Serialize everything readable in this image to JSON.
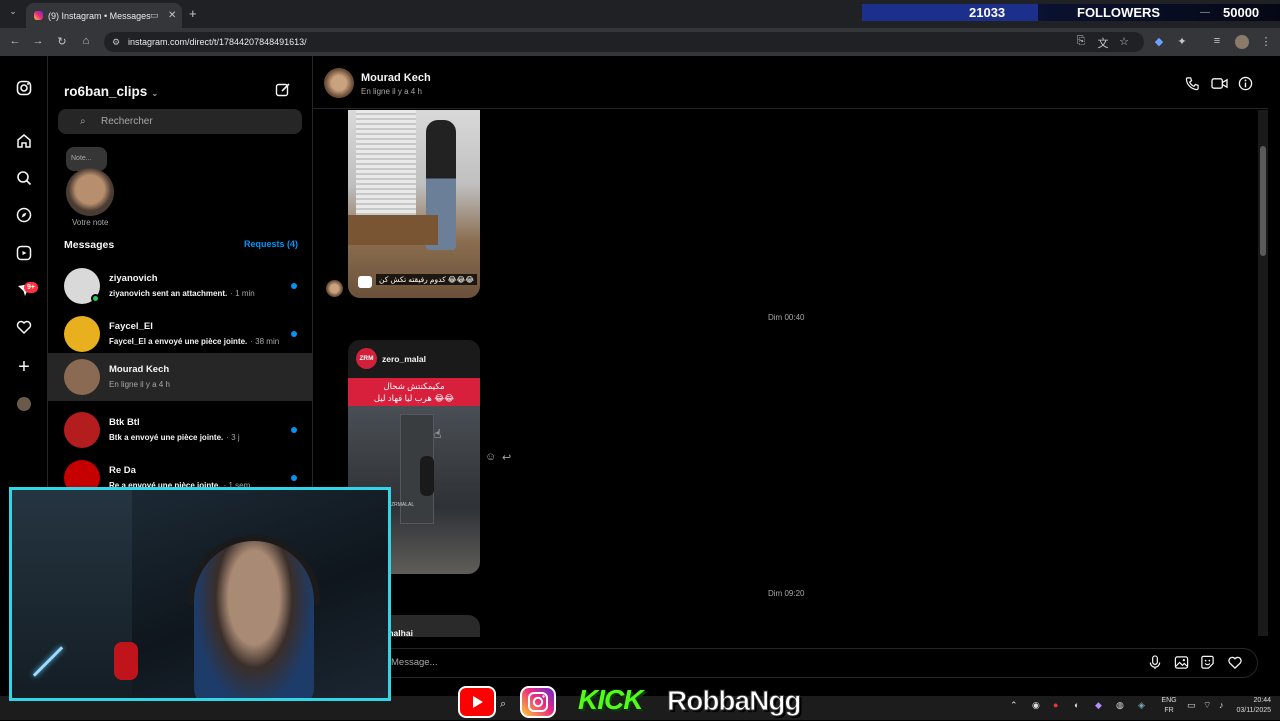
{
  "browser": {
    "tab_title": "(9) Instagram • Messages",
    "url": "instagram.com/direct/t/17844207848491613/"
  },
  "overlay": {
    "followers_current": "21033",
    "followers_label": "FOLLOWERS",
    "followers_goal": "50000",
    "progress_fraction": 0.42,
    "stream_name": "RobbaNgg",
    "kick_label": "KICK"
  },
  "sidebar": {
    "notification_badge": "9+"
  },
  "inbox": {
    "account": "ro6ban_clips",
    "search_placeholder": "Rechercher",
    "note_bubble": "Note...",
    "note_caption": "Votre note",
    "messages_heading": "Messages",
    "requests_label": "Requests (4)",
    "conversations": [
      {
        "name": "ziyanovich",
        "preview": "ziyanovich sent an attachment.",
        "time": "· 1 min",
        "unread": true,
        "color": "#d9d9d9"
      },
      {
        "name": "Faycel_El",
        "preview": "Faycel_El a envoyé une pièce jointe.",
        "time": "· 38 min",
        "unread": true,
        "color": "#e8b01e"
      },
      {
        "name": "Mourad Kech",
        "preview": "En ligne il y a 4 h",
        "time": "",
        "unread": false,
        "color": "#8a6a52"
      },
      {
        "name": "Btk Btl",
        "preview": "Btk a envoyé une pièce jointe.",
        "time": "· 3 j",
        "unread": true,
        "color": "#b31d1d"
      },
      {
        "name": "Re Da",
        "preview": "Re a envoyé une pièce jointe.",
        "time": "· 1 sem.",
        "unread": true,
        "color": "#c40000"
      }
    ]
  },
  "chat": {
    "contact_name": "Mourad Kech",
    "contact_status": "En ligne il y a 4 h",
    "reel1_caption": "كدوم رفيقته تكش كن 😂😂😂",
    "day_sep_1": "Dim 00:40",
    "reel2_account": "zero_malal",
    "reel2_logo": "ZRM",
    "reel2_text_line1": "مكيمكنتش شحال",
    "reel2_text_line2": "هرب ليا فهاد ليل 😂😂",
    "reel2_watermark": "@ZRMALAL",
    "day_sep_2": "Dim 09:20",
    "reel3_partial": "malhai",
    "message_placeholder": "Message..."
  },
  "taskbar": {
    "lang_top": "ENG",
    "lang_bottom": "FR",
    "time": "20:44",
    "date": "03/11/2025"
  }
}
